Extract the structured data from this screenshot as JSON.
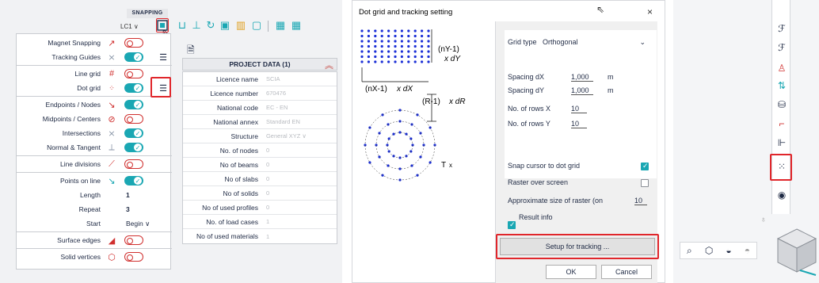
{
  "snapping": {
    "badge": "SNAPPING",
    "load_case": "LC1",
    "rows": [
      {
        "label": "Magnet Snapping",
        "icon": "magnet-icon",
        "state": "off"
      },
      {
        "label": "Tracking Guides",
        "icon": "tracking-icon",
        "state": "on"
      },
      {
        "label": "Line grid",
        "icon": "line-grid-icon",
        "state": "off"
      },
      {
        "label": "Dot grid",
        "icon": "dot-grid-icon",
        "state": "on"
      },
      {
        "label": "Endpoints / Nodes",
        "icon": "endpoint-icon",
        "state": "on"
      },
      {
        "label": "Midpoints / Centers",
        "icon": "midpoint-icon",
        "state": "off"
      },
      {
        "label": "Intersections",
        "icon": "intersection-icon",
        "state": "on"
      },
      {
        "label": "Normal & Tangent",
        "icon": "normal-icon",
        "state": "on"
      },
      {
        "label": "Line divisions",
        "icon": "line-division-icon",
        "state": "off"
      },
      {
        "label": "Points on line",
        "icon": "points-on-line-icon",
        "state": "on"
      },
      {
        "label": "Length",
        "value": "1"
      },
      {
        "label": "Repeat",
        "value": "3"
      },
      {
        "label": "Start",
        "value": "Begin"
      },
      {
        "label": "Surface edges",
        "icon": "surface-edge-icon",
        "state": "off"
      },
      {
        "label": "Solid vertices",
        "icon": "solid-vertex-icon",
        "state": "off"
      }
    ]
  },
  "project": {
    "header": "PROJECT DATA (1)",
    "rows": [
      {
        "key": "Licence name",
        "value": "SCIA"
      },
      {
        "key": "Licence number",
        "value": "670476"
      },
      {
        "key": "National code",
        "value": "EC - EN"
      },
      {
        "key": "National annex",
        "value": "Standard EN"
      },
      {
        "key": "Structure",
        "value": "General XYZ"
      },
      {
        "key": "No. of nodes",
        "value": "0"
      },
      {
        "key": "No of beams",
        "value": "0"
      },
      {
        "key": "No of slabs",
        "value": "0"
      },
      {
        "key": "No of solids",
        "value": "0"
      },
      {
        "key": "No of used profiles",
        "value": "0"
      },
      {
        "key": "No. of load cases",
        "value": "1"
      },
      {
        "key": "No of used materials",
        "value": "1"
      }
    ]
  },
  "dialog": {
    "title": "Dot grid and tracking setting",
    "close": "×",
    "grid_type_label": "Grid type",
    "grid_type_value": "Orthogonal",
    "spacing_dx_label": "Spacing dX",
    "spacing_dx_value": "1,000",
    "spacing_dy_label": "Spacing dY",
    "spacing_dy_value": "1,000",
    "unit": "m",
    "rows_x_label": "No. of rows X",
    "rows_x_value": "10",
    "rows_y_label": "No. of rows Y",
    "rows_y_value": "10",
    "snap_label": "Snap cursor to dot grid",
    "raster_label": "Raster over screen",
    "approx_label": "Approximate size of raster (on",
    "approx_value": "10",
    "result_label": "Result info",
    "setup_button": "Setup for tracking ...",
    "ok_button": "OK",
    "cancel_button": "Cancel",
    "illus": {
      "ny": "(nY-1)",
      "dy": "x dY",
      "nx": "(nX-1)",
      "dx": "x dX",
      "r": "(R-1)",
      "dr": "x dR",
      "t": "T",
      "tx": "x"
    }
  },
  "colors": {
    "accent": "#1aa7b3",
    "highlight": "#e0262b",
    "dots": "#1b2fd6"
  }
}
